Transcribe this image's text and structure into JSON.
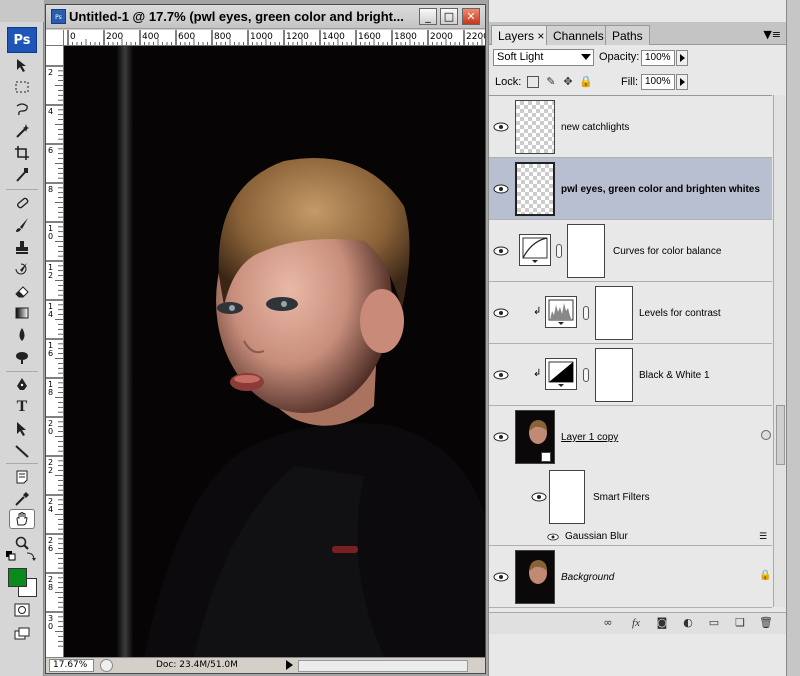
{
  "app": {
    "logo": "Ps"
  },
  "document": {
    "title": "Untitled-1 @ 17.7% (pwl eyes, green color and bright...",
    "icon_label": "Ps",
    "ruler_labels": [
      "0",
      "200",
      "400",
      "600",
      "800",
      "1000",
      "1200",
      "1400",
      "1600",
      "1800",
      "2000",
      "2200"
    ],
    "vruler_labels": [
      "2",
      "4",
      "6",
      "8",
      "10",
      "12",
      "14",
      "16",
      "18",
      "20",
      "22",
      "24",
      "26",
      "28",
      "30"
    ],
    "zoom": "17.67%",
    "doc_info": "Doc: 23.4M/51.0M"
  },
  "window_buttons": {
    "minimize": "_",
    "maximize": "□",
    "close": "✕"
  },
  "tools": [
    "move-tool",
    "marquee-tool",
    "lasso-tool",
    "magic-wand-tool",
    "crop-tool",
    "eyedropper-tool",
    "healing-brush-tool",
    "brush-tool",
    "clone-stamp-tool",
    "history-brush-tool",
    "eraser-tool",
    "gradient-tool",
    "blur-tool",
    "dodge-tool",
    "pen-tool",
    "type-tool",
    "path-selection-tool",
    "line-tool",
    "notes-tool",
    "eyedropper2-tool",
    "hand-tool",
    "zoom-tool"
  ],
  "colors": {
    "foreground": "#0a8a1e",
    "background": "#ffffff",
    "selection": "#b8bfd0"
  },
  "panel": {
    "tabs": [
      "Layers",
      "Channels",
      "Paths"
    ],
    "tab_close": "×",
    "blend_mode": "Soft Light",
    "opacity_label": "Opacity:",
    "opacity_value": "100%",
    "lock_label": "Lock:",
    "fill_label": "Fill:",
    "fill_value": "100%"
  },
  "layers": [
    {
      "name": "new catchlights",
      "type": "pixel",
      "visible": true,
      "selected": false
    },
    {
      "name": "pwl eyes, green color and brighten whites",
      "type": "pixel",
      "visible": true,
      "selected": true
    },
    {
      "name": "Curves for color balance",
      "type": "curves-adjustment",
      "visible": true,
      "selected": false
    },
    {
      "name": "Levels for contrast",
      "type": "levels-adjustment",
      "visible": true,
      "selected": false,
      "clipped": true
    },
    {
      "name": "Black & White 1",
      "type": "black-white-adjustment",
      "visible": true,
      "selected": false,
      "clipped": true
    },
    {
      "name": "Layer 1 copy",
      "type": "smart-object",
      "visible": true,
      "selected": false
    },
    {
      "name": "Smart Filters",
      "type": "smart-filters",
      "visible": true,
      "selected": false
    },
    {
      "name": "Gaussian Blur",
      "type": "filter",
      "visible": true,
      "selected": false
    },
    {
      "name": "Background",
      "type": "background",
      "visible": true,
      "selected": false,
      "locked": true
    }
  ],
  "bottom_icons": [
    "link-layers-icon",
    "fx-icon",
    "add-mask-icon",
    "new-adjustment-icon",
    "new-group-icon",
    "new-layer-icon",
    "trash-icon"
  ]
}
